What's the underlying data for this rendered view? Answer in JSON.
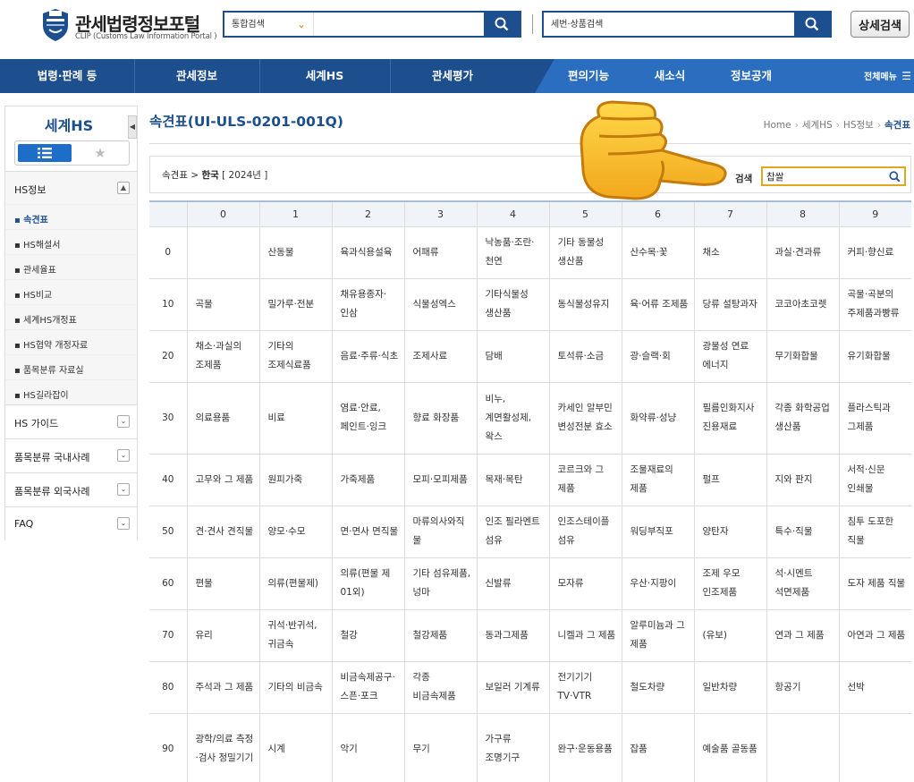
{
  "header": {
    "logo_title": "관세법령정보포털",
    "logo_sub": "CLIP (Customs Law Information Portal )",
    "search1_select": "통합검색",
    "search2_select": "세번·상품검색",
    "detail_search": "상세검색"
  },
  "nav": {
    "items": [
      "법령·판례 등",
      "관세정보",
      "세계HS",
      "관세평가",
      "편의기능",
      "새소식",
      "정보공개"
    ],
    "all_menu": "전체메뉴"
  },
  "sidebar": {
    "title": "세계HS",
    "sections": [
      "HS정보",
      "HS 가이드",
      "품목분류 국내사례",
      "품목분류 외국사례",
      "FAQ"
    ],
    "hs_items": [
      "속견표",
      "HS해설서",
      "관세율표",
      "HS비교",
      "세계HS개정표",
      "HS협약 개정자료",
      "품목분류 자료실",
      "HS길라잡이"
    ]
  },
  "page": {
    "title": "속견표(UI-ULS-0201-001Q)",
    "breadcrumb": [
      "Home",
      "세계HS",
      "HS정보",
      "속견표"
    ],
    "filter_path_prefix": "속견표 > ",
    "filter_country": "한국",
    "filter_year": " [ 2024년 ]",
    "search_label": "검색",
    "search_value": "찹쌀"
  },
  "table": {
    "headers": [
      "",
      "0",
      "1",
      "2",
      "3",
      "4",
      "5",
      "6",
      "7",
      "8",
      "9"
    ],
    "rows": [
      {
        "label": "0",
        "cells": [
          "",
          "산동물",
          "육과식용설육",
          "어패류",
          "낙농품·조란·천연",
          "기타 동물성 생산품",
          "산수목·꽃",
          "채소",
          "과실·견과류",
          "커피·향신료"
        ]
      },
      {
        "label": "10",
        "cells": [
          "곡물",
          "밀가루·전분",
          "채유용종자·인삼",
          "식물성엑스",
          "기타식물성 생산품",
          "동식물성유지",
          "육·어류 조제품",
          "당류 설탕과자",
          "코코아초코렛",
          "곡물·곡분의 주제품과빵류"
        ]
      },
      {
        "label": "20",
        "cells": [
          "채소·과실의 조제품",
          "기타의 조제식료품",
          "음료·주류·식초",
          "조제사료",
          "담배",
          "토석류·소금",
          "광·슬랙·회",
          "광물성 연료 에너지",
          "무기화합물",
          "유기화합물"
        ]
      },
      {
        "label": "30",
        "cells": [
          "의료용품",
          "비료",
          "염료·안료,페인트·잉크",
          "향료 화장품",
          "비누, 계면활성제, 왁스",
          "카세인 알부민 변성전분 효소",
          "화약류·성냥",
          "필름인화지사진용재료",
          "각종 화학공업 생산품",
          "플라스틱과 그제품"
        ]
      },
      {
        "label": "40",
        "cells": [
          "고무와 그 제품",
          "원피가죽",
          "가죽제품",
          "모피·모피제품",
          "목재·목탄",
          "코르크와 그 제품",
          "조물재료의 제품",
          "펄프",
          "지와 판지",
          "서적·신문 인쇄물"
        ]
      },
      {
        "label": "50",
        "cells": [
          "견·견사 견직물",
          "양모·수모",
          "면·면사 면직물",
          "마류의사와직물",
          "인조 필라멘트 섬유",
          "인조스테이플섬유",
          "워딩부직포",
          "양탄자",
          "특수·직물",
          "침투 도포한 직물"
        ]
      },
      {
        "label": "60",
        "cells": [
          "편물",
          "의류(편물제)",
          "의류(편물 제 01외)",
          "기타 섬유제품,넝마",
          "신발류",
          "모자류",
          "우산·지팡이",
          "조제 우모 인조제품",
          "석·시멘트 석면제품",
          "도자 제품 직물"
        ]
      },
      {
        "label": "70",
        "cells": [
          "유리",
          "귀석·반귀석, 귀금속",
          "철강",
          "철강제품",
          "동과그제품",
          "니켈과 그 제품",
          "알루미늄과 그 제품",
          "(유보)",
          "연과 그 제품",
          "아연과 그 제품"
        ]
      },
      {
        "label": "80",
        "cells": [
          "주석과 그 제품",
          "기타의 비금속",
          "비금속제공구·스픈·포크",
          "각종 비금속제품",
          "보일러 기계류",
          "전기기기 TV·VTR",
          "철도차량",
          "일반차량",
          "항공기",
          "선박"
        ]
      },
      {
        "label": "90",
        "cells": [
          "광학/의료 측정·검사 정밀기기",
          "시계",
          "악기",
          "무기",
          "가구류 조명기구",
          "완구·운동용품",
          "잡품",
          "예술품 골동품",
          "",
          ""
        ]
      }
    ]
  }
}
